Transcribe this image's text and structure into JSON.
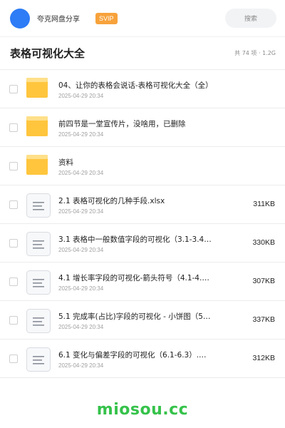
{
  "header": {
    "app_name": "夸克网盘分享",
    "badge": "SVIP",
    "search_placeholder": "搜索",
    "avatar_color": "#2e7cf6"
  },
  "folder": {
    "title": "表格可视化大全",
    "meta": "共 74 项 · 1.2G"
  },
  "items": [
    {
      "type": "folder",
      "icon": "folder-icon",
      "name": "04、让你的表格会说话-表格可视化大全（全）",
      "date": "2025-04-29 20:34",
      "size": ""
    },
    {
      "type": "folder",
      "icon": "folder-icon",
      "name": "前四节是一堂宣传片，没啥用，已删除",
      "date": "2025-04-29 20:34",
      "size": ""
    },
    {
      "type": "folder",
      "icon": "folder-icon",
      "name": "资料",
      "date": "2025-04-29 20:34",
      "size": ""
    },
    {
      "type": "file",
      "icon": "document-icon",
      "name": "2.1 表格可视化的几种手段.xlsx",
      "date": "2025-04-29 20:34",
      "size": "311KB"
    },
    {
      "type": "file",
      "icon": "document-icon",
      "name": "3.1 表格中一般数值字段的可视化（3.1-3.4…",
      "date": "2025-04-29 20:34",
      "size": "330KB"
    },
    {
      "type": "file",
      "icon": "document-icon",
      "name": "4.1 增长率字段的可视化-箭头符号（4.1-4.…",
      "date": "2025-04-29 20:34",
      "size": "307KB"
    },
    {
      "type": "file",
      "icon": "document-icon",
      "name": "5.1 完成率(占比)字段的可视化 - 小饼图（5…",
      "date": "2025-04-29 20:34",
      "size": "337KB"
    },
    {
      "type": "file",
      "icon": "document-icon",
      "name": "6.1 变化与偏差字段的可视化（6.1-6.3）.…",
      "date": "2025-04-29 20:34",
      "size": "312KB"
    }
  ],
  "watermark": "miosou.cc",
  "colors": {
    "folder": "#ffc53d",
    "badge": "#f7a23b",
    "watermark": "#35c24a"
  }
}
